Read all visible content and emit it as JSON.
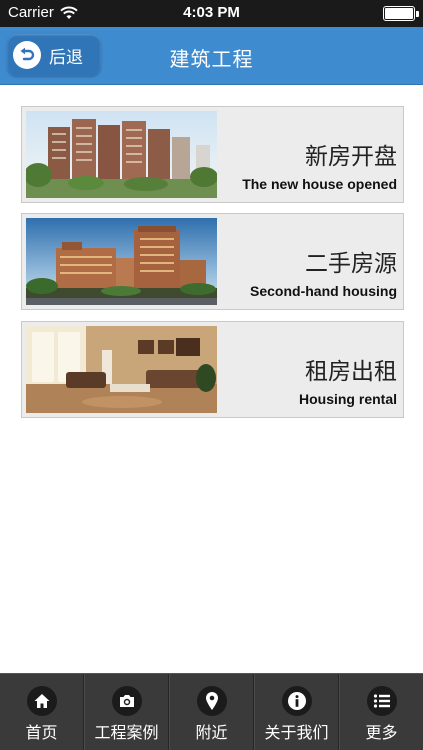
{
  "status_bar": {
    "carrier": "Carrier",
    "time": "4:03 PM"
  },
  "nav": {
    "back_label": "后退",
    "title": "建筑工程"
  },
  "cards": [
    {
      "title": "新房开盘",
      "subtitle": "The new house opened",
      "image": "high-rise-residential-towers-photo"
    },
    {
      "title": "二手房源",
      "subtitle": "Second-hand housing",
      "image": "apartment-complex-evening-photo"
    },
    {
      "title": "租房出租",
      "subtitle": "Housing rental",
      "image": "furnished-living-room-photo"
    }
  ],
  "tabs": [
    {
      "label": "首页",
      "icon": "home-icon"
    },
    {
      "label": "工程案例",
      "icon": "camera-icon"
    },
    {
      "label": "附近",
      "icon": "location-pin-icon"
    },
    {
      "label": "关于我们",
      "icon": "info-icon"
    },
    {
      "label": "更多",
      "icon": "list-icon"
    }
  ],
  "colors": {
    "nav_bar": "#3f8bd0",
    "tab_bar": "#3a3a3a",
    "status_bar": "#1a1a1a",
    "card_bg": "#ececec"
  }
}
